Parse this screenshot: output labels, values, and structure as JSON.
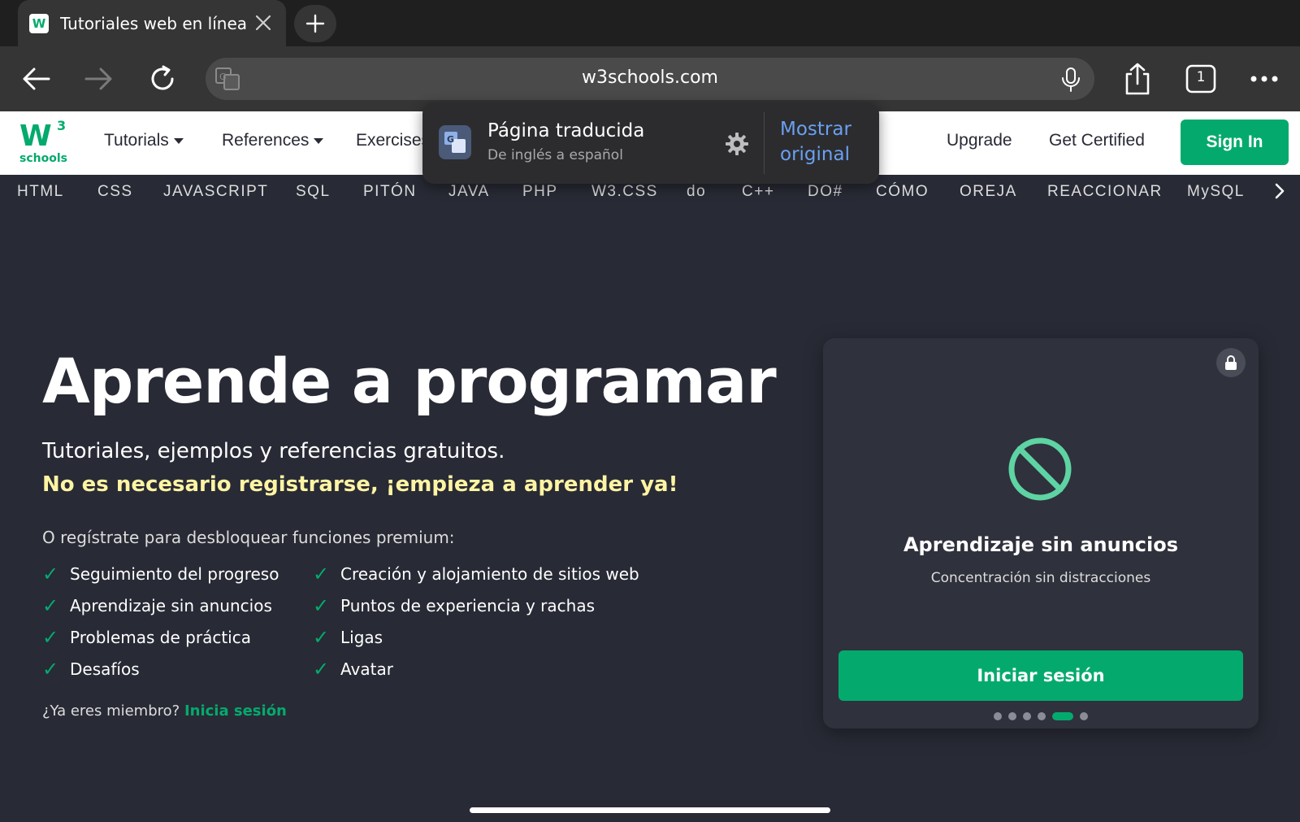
{
  "browser": {
    "tab_title": "Tutoriales web en línea c",
    "url": "w3schools.com",
    "tab_count": "1"
  },
  "translate_popup": {
    "title": "Página traducida",
    "subtitle": "De inglés a español",
    "show_original": "Mostrar original"
  },
  "sitenav": {
    "logo_mark": "W",
    "logo_sup": "3",
    "logo_word": "schools",
    "tutorials": "Tutorials",
    "references": "References",
    "exercises": "Exercises",
    "upgrade": "Upgrade",
    "get_certified": "Get Certified",
    "sign_in": "Sign In"
  },
  "languages": [
    "HTML",
    "CSS",
    "JAVASCRIPT",
    "SQL",
    "PITÓN",
    "JAVA",
    "PHP",
    "W3.CSS",
    "do",
    "C++",
    "DO#",
    "CÓMO",
    "OREJA",
    "REACCIONAR",
    "MySQL"
  ],
  "hero": {
    "title": "Aprende a programar",
    "subtitle": "Tutoriales, ejemplos y referencias gratuitos.",
    "highlight": "No es necesario registrarse, ¡empieza a aprender ya!",
    "register_text": "O regístrate para desbloquear funciones premium:",
    "features_left": [
      "Seguimiento del progreso",
      "Aprendizaje sin anuncios",
      "Problemas de práctica",
      "Desafíos"
    ],
    "features_right": [
      "Creación y alojamiento de sitios web",
      "Puntos de experiencia y rachas",
      "Ligas",
      "Avatar"
    ],
    "member_text": "¿Ya eres miembro?",
    "member_link": "Inicia sesión"
  },
  "card": {
    "title": "Aprendizaje sin anuncios",
    "subtitle": "Concentración sin distracciones",
    "button": "Iniciar sesión",
    "dots_total": 6,
    "dots_active_index": 4
  },
  "colors": {
    "brand_green": "#04AA6D",
    "highlight_yellow": "#FFF4A3",
    "page_bg": "#282A35",
    "link_blue": "#6AA0F0"
  }
}
